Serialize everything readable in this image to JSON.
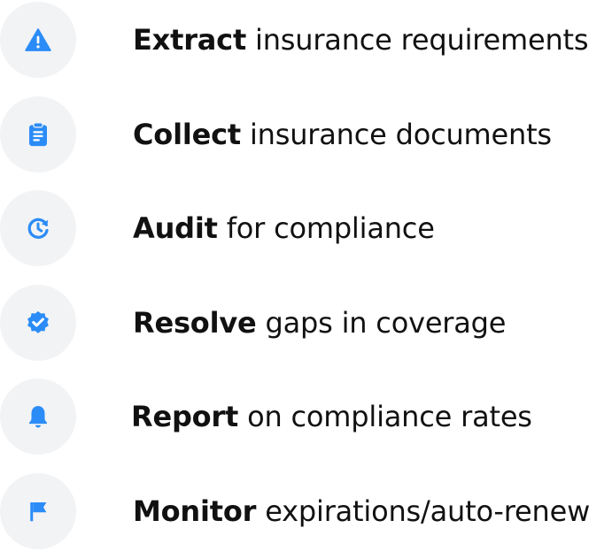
{
  "colors": {
    "accent": "#2b8cf7",
    "circle_bg": "#f2f3f5",
    "text": "#111111"
  },
  "features": [
    {
      "icon": "warning-icon",
      "verb": "Extract",
      "rest": " insurance requirements"
    },
    {
      "icon": "clipboard-icon",
      "verb": "Collect",
      "rest": " insurance documents"
    },
    {
      "icon": "audit-clock-icon",
      "verb": "Audit",
      "rest": " for compliance"
    },
    {
      "icon": "verified-badge-icon",
      "verb": "Resolve",
      "rest": " gaps in coverage"
    },
    {
      "icon": "bell-icon",
      "verb": "Report",
      "rest": " on compliance rates"
    },
    {
      "icon": "flag-icon",
      "verb": "Monitor",
      "rest": " expirations/auto-renew"
    }
  ]
}
